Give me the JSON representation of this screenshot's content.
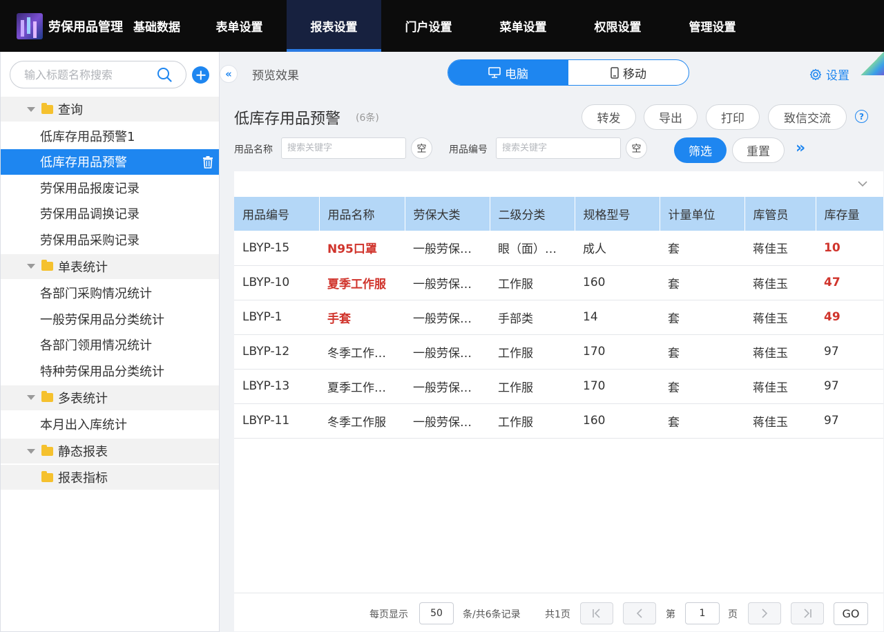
{
  "brand": {
    "title": "劳保用品管理"
  },
  "nav": {
    "tabs": [
      {
        "label": "基础数据"
      },
      {
        "label": "表单设置"
      },
      {
        "label": "报表设置"
      },
      {
        "label": "门户设置"
      },
      {
        "label": "菜单设置"
      },
      {
        "label": "权限设置"
      },
      {
        "label": "管理设置"
      }
    ],
    "active_index": 2
  },
  "sidebar": {
    "search_placeholder": "输入标题名称搜索",
    "groups": [
      {
        "label": "查询",
        "items": [
          "低库存用品预警1",
          "低库存用品预警",
          "劳保用品报废记录",
          "劳保用品调换记录",
          "劳保用品采购记录"
        ]
      },
      {
        "label": "单表统计",
        "items": [
          "各部门采购情况统计",
          "一般劳保用品分类统计",
          "各部门领用情况统计",
          "特种劳保用品分类统计"
        ]
      },
      {
        "label": "多表统计",
        "items": [
          "本月出入库统计"
        ]
      },
      {
        "label": "静态报表",
        "items": []
      },
      {
        "label": "报表指标",
        "items": []
      }
    ],
    "active_item": "低库存用品预警"
  },
  "header": {
    "preview_label": "预览效果",
    "device_pc": "电脑",
    "device_mobile": "移动",
    "settings_label": "设置"
  },
  "report": {
    "title": "低库存用品预警",
    "count": "(6条)",
    "actions": {
      "forward": "转发",
      "export": "导出",
      "print": "打印",
      "zhixin": "致信交流"
    },
    "help": "?"
  },
  "filters": {
    "name_label": "用品名称",
    "name_placeholder": "搜索关键字",
    "code_label": "用品编号",
    "code_placeholder": "搜索关键字",
    "clear_label": "空",
    "filter_button": "筛选",
    "reset_button": "重置"
  },
  "table": {
    "columns": [
      "用品编号",
      "用品名称",
      "劳保大类",
      "二级分类",
      "规格型号",
      "计量单位",
      "库管员",
      "库存量"
    ],
    "rows": [
      {
        "cells": [
          "LBYP-15",
          "N95口罩",
          "一般劳保…",
          "眼（面）…",
          "成人",
          "套",
          "蒋佳玉",
          "10"
        ],
        "warn": true
      },
      {
        "cells": [
          "LBYP-10",
          "夏季工作服",
          "一般劳保…",
          "工作服",
          "160",
          "套",
          "蒋佳玉",
          "47"
        ],
        "warn": true
      },
      {
        "cells": [
          "LBYP-1",
          "手套",
          "一般劳保…",
          "手部类",
          "14",
          "套",
          "蒋佳玉",
          "49"
        ],
        "warn": true
      },
      {
        "cells": [
          "LBYP-12",
          "冬季工作…",
          "一般劳保…",
          "工作服",
          "170",
          "套",
          "蒋佳玉",
          "97"
        ],
        "warn": false
      },
      {
        "cells": [
          "LBYP-13",
          "夏季工作…",
          "一般劳保…",
          "工作服",
          "170",
          "套",
          "蒋佳玉",
          "97"
        ],
        "warn": false
      },
      {
        "cells": [
          "LBYP-11",
          "冬季工作服",
          "一般劳保…",
          "工作服",
          "160",
          "套",
          "蒋佳玉",
          "97"
        ],
        "warn": false
      }
    ]
  },
  "pager": {
    "per_page_label": "每页显示",
    "per_page_value": "50",
    "total_label": "条/共6条记录",
    "pages_label": "共1页",
    "page_prefix": "第",
    "page_value": "1",
    "page_suffix": "页",
    "go_label": "GO"
  },
  "colors": {
    "accent": "#1e86f0",
    "warning": "#d0342c",
    "header_bg": "#0c0c0c",
    "table_header": "#b4d7f7"
  }
}
